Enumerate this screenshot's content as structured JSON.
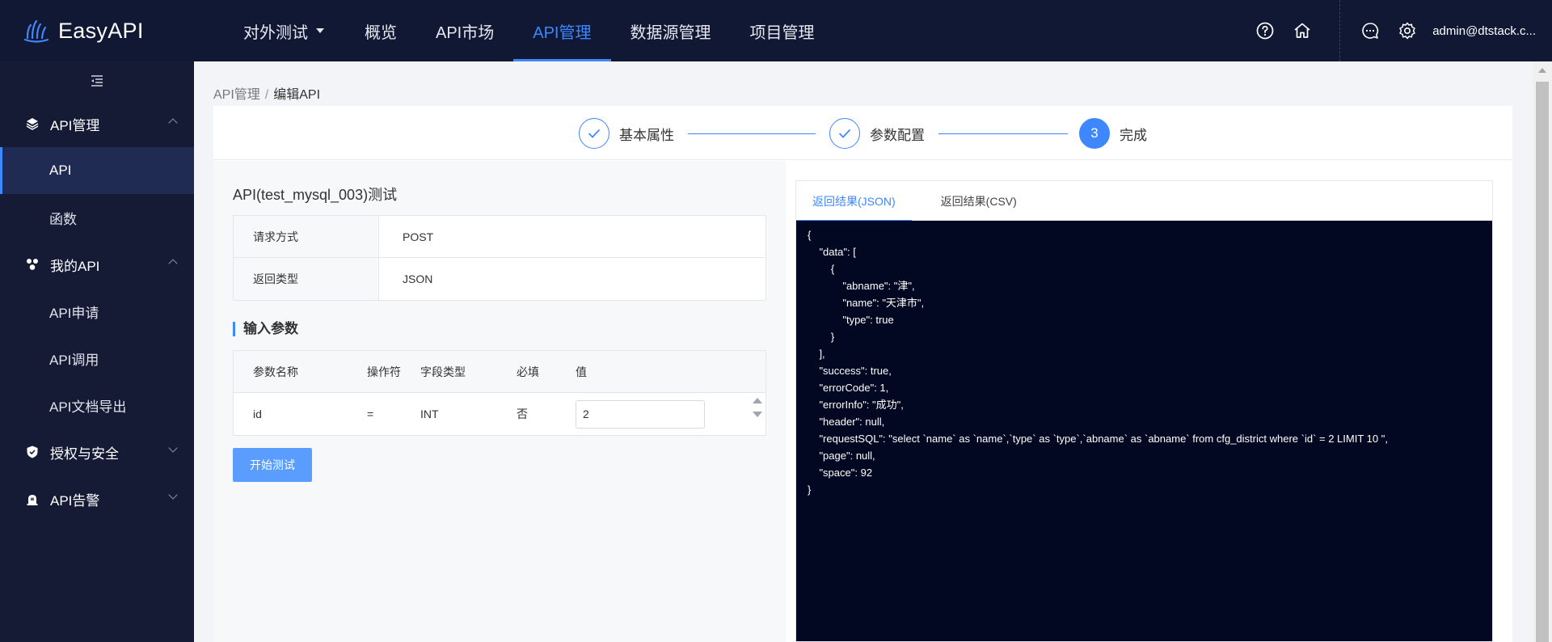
{
  "app": {
    "name": "EasyAPI"
  },
  "nav": {
    "project": "对外测试",
    "items": [
      "概览",
      "API市场",
      "API管理",
      "数据源管理",
      "项目管理"
    ],
    "active_index": 2
  },
  "header": {
    "user": "admin@dtstack.c..."
  },
  "sidebar": {
    "groups": [
      {
        "label": "API管理",
        "icon": "layers-icon",
        "expanded": true,
        "items": [
          "API",
          "函数"
        ]
      },
      {
        "label": "我的API",
        "icon": "cluster-icon",
        "expanded": true,
        "items": [
          "API申请",
          "API调用",
          "API文档导出"
        ]
      },
      {
        "label": "授权与安全",
        "icon": "shield-icon",
        "expanded": false,
        "items": []
      },
      {
        "label": "API告警",
        "icon": "alarm-icon",
        "expanded": false,
        "items": []
      }
    ],
    "active_item": "API"
  },
  "breadcrumb": {
    "parent": "API管理",
    "sep": "/",
    "current": "编辑API"
  },
  "steps": [
    {
      "label": "基本属性",
      "state": "done"
    },
    {
      "label": "参数配置",
      "state": "done"
    },
    {
      "label": "完成",
      "state": "current",
      "number": "3"
    }
  ],
  "test": {
    "title": "API(test_mysql_003)测试",
    "info": [
      {
        "key": "请求方式",
        "value": "POST"
      },
      {
        "key": "返回类型",
        "value": "JSON"
      }
    ],
    "params_title": "输入参数",
    "param_headers": [
      "参数名称",
      "操作符",
      "字段类型",
      "必填",
      "值"
    ],
    "params": [
      {
        "name": "id",
        "op": "=",
        "type": "INT",
        "required": "否",
        "value": "2"
      }
    ],
    "start_button": "开始测试"
  },
  "result": {
    "tabs": [
      "返回结果(JSON)",
      "返回结果(CSV)"
    ],
    "active_tab": 0,
    "json_text": "{\n    \"data\": [\n        {\n            \"abname\": \"津\",\n            \"name\": \"天津市\",\n            \"type\": true\n        }\n    ],\n    \"success\": true,\n    \"errorCode\": 1,\n    \"errorInfo\": \"成功\",\n    \"header\": null,\n    \"requestSQL\": \"select `name` as `name`,`type` as `type`,`abname` as `abname` from cfg_district where `id` = 2 LIMIT 10 \",\n    \"page\": null,\n    \"space\": 92\n}"
  },
  "colors": {
    "accent": "#3f87ff",
    "topbar": "#111833",
    "sidebar": "#151b35",
    "code_bg": "#020822"
  }
}
